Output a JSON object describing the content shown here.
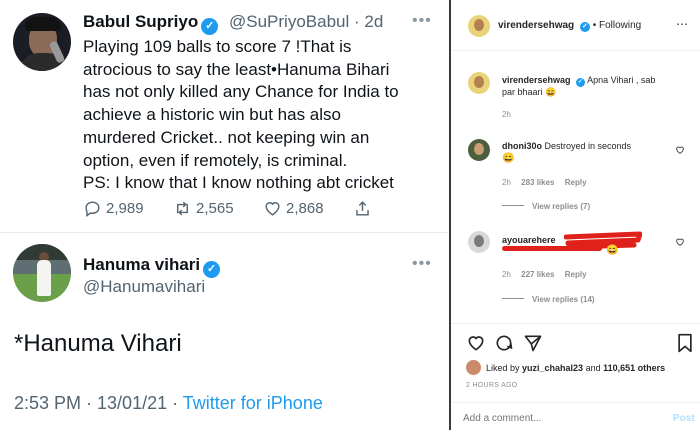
{
  "tweet1": {
    "name": "Babul Supriyo",
    "handle": "@SuPriyoBabul",
    "time": "· 2d",
    "lines": [
      "Playing 109 balls to score 7 !That is",
      "atrocious to say the least•Hanuma Bihari",
      "has not only killed any Chance for India to",
      "achieve a historic win but has also",
      "murdered Cricket.. not keeping win an",
      "option, even if remotely, is criminal.",
      "PS: I know that I know nothing abt cricket"
    ],
    "replies": "2,989",
    "retweets": "2,565",
    "likes": "2,868"
  },
  "tweet2": {
    "name": "Hanuma vihari",
    "handle": "@Hanumavihari",
    "text": "*Hanuma Vihari",
    "time": "2:53 PM · 13/01/21 · ",
    "source": "Twitter for iPhone"
  },
  "instagram": {
    "header_user": "virendersehwag",
    "following": "• Following",
    "caption_user": "virendersehwag",
    "caption": "Apna Vihari , sab",
    "caption2": "par bhaari 😄",
    "caption_time": "2h",
    "comments": [
      {
        "user": "dhoni30o",
        "text": "Destroyed in seconds",
        "emoji": "😄",
        "time": "2h",
        "likes": "283 likes",
        "reply": "Reply",
        "view_replies": "View replies (7)"
      },
      {
        "user": "ayouarehere",
        "text": "",
        "emoji": "😄",
        "time": "2h",
        "likes": "227 likes",
        "reply": "Reply",
        "view_replies": "View replies (14)"
      }
    ],
    "liked_by_prefix": "Liked by ",
    "liked_by_user": "yuzi_chahal23",
    "liked_by_mid": " and ",
    "liked_by_count": "110,651 others",
    "post_time": "2 HOURS AGO",
    "add_comment_placeholder": "Add a comment...",
    "post_button": "Post"
  }
}
